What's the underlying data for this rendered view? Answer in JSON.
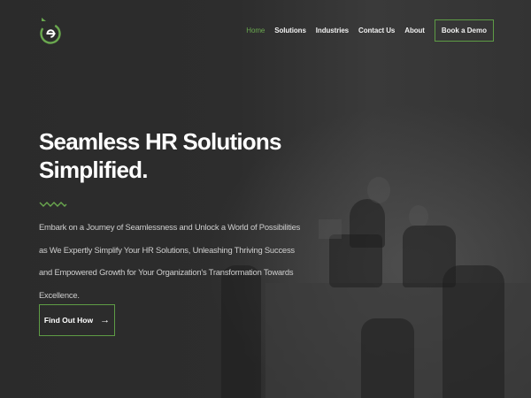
{
  "nav": {
    "items": [
      {
        "label": "Home",
        "active": true
      },
      {
        "label": "Solutions",
        "active": false
      },
      {
        "label": "Industries",
        "active": false
      },
      {
        "label": "Contact Us",
        "active": false
      },
      {
        "label": "About",
        "active": false
      }
    ],
    "demo_label": "Book a Demo"
  },
  "hero": {
    "title_line1": "Seamless HR Solutions",
    "title_line2": "Simplified.",
    "description": "Embark on a Journey of Seamlessness and Unlock a World of Possibilities as We Expertly Simplify Your HR Solutions, Unleashing Thriving Success and Empowered Growth for Your Organization's Transformation Towards Excellence.",
    "cta_label": "Find Out How"
  },
  "colors": {
    "accent": "#5e9c45",
    "background": "#2a2a2a",
    "text": "#ffffff"
  },
  "icons": {
    "logo": "e-logo-icon",
    "cta_arrow": "arrow-right-icon"
  }
}
